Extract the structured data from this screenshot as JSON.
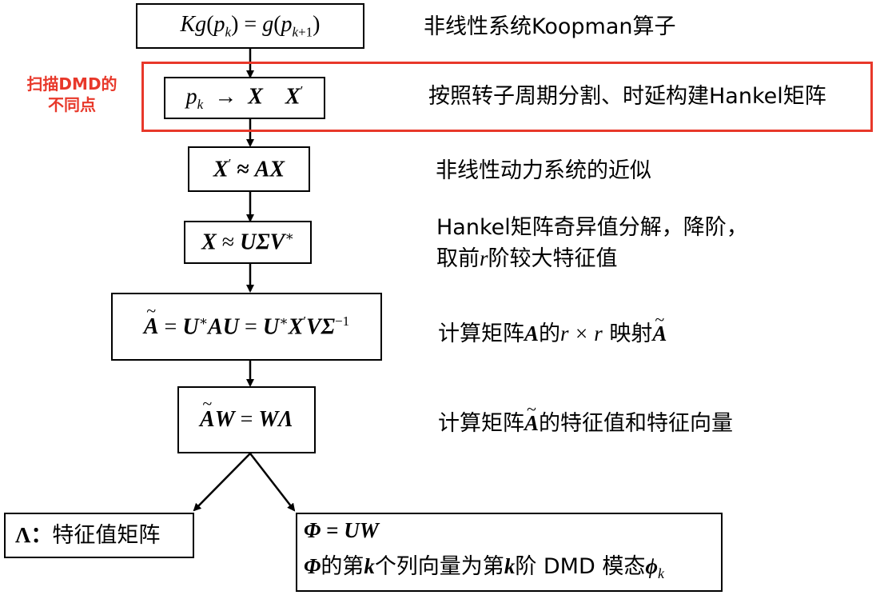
{
  "annotation": {
    "line1": "扫描DMD的",
    "line2": "不同点"
  },
  "descriptions": {
    "step1": "非线性系统Koopman算子",
    "step2": "按照转子周期分割、时延构建Hankel矩阵",
    "step3": "非线性动力系统的近似",
    "step4_line1": "Hankel矩阵奇异值分解，降阶，",
    "step4_line2a": "取前",
    "step4_line2_var": "r",
    "step4_line2b": "阶较大特征值",
    "step5a": "计算矩阵",
    "step5_var": "A",
    "step5b": "的",
    "step5_dims": "r × r",
    "step5c": " 映射",
    "step6a": "计算矩阵",
    "step6b": "的特征值和特征向量"
  },
  "leaf_left": {
    "symbol": "Λ：",
    "text": "特征值矩阵"
  },
  "leaf_right": {
    "line1": "Φ = UW",
    "line2_sym": "Φ",
    "line2a": "的第",
    "line2_k1": "k",
    "line2b": "个列向量为第",
    "line2_k2": "k",
    "line2c": "阶 DMD 模态",
    "line2_phi": "ϕ",
    "line2_sub": "k"
  },
  "colors": {
    "highlight": "#e8382a",
    "stroke": "#000000"
  }
}
